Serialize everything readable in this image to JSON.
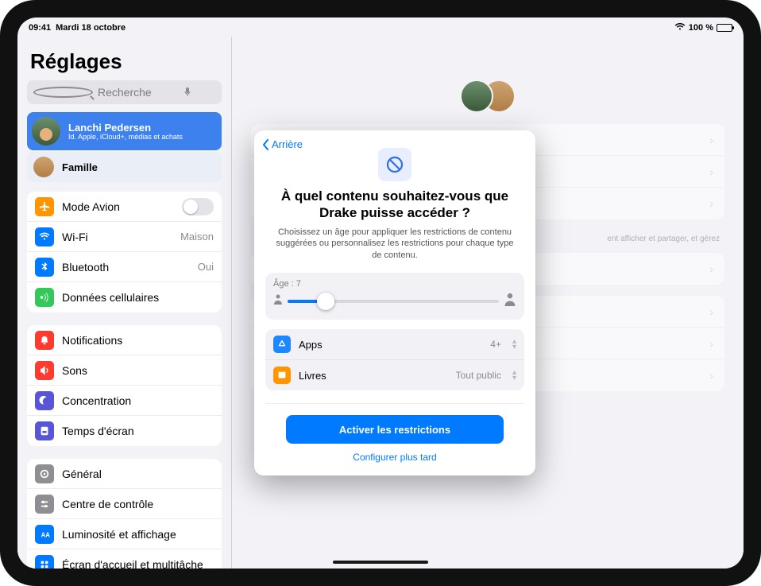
{
  "statusbar": {
    "time": "09:41",
    "date": "Mardi 18 octobre",
    "battery_text": "100 %"
  },
  "sidebar": {
    "title": "Réglages",
    "search_placeholder": "Recherche",
    "account": {
      "name": "Lanchi Pedersen",
      "sub": "Id. Apple, iCloud+, médias et achats"
    },
    "family_label": "Famille",
    "items": {
      "airplane": "Mode Avion",
      "wifi": "Wi-Fi",
      "wifi_value": "Maison",
      "bluetooth": "Bluetooth",
      "bluetooth_value": "Oui",
      "cellular": "Données cellulaires",
      "notifications": "Notifications",
      "sounds": "Sons",
      "focus": "Concentration",
      "screentime": "Temps d'écran",
      "general": "Général",
      "control_center": "Centre de contrôle",
      "display": "Luminosité et affichage",
      "home_screen": "Écran d'accueil et multitâche"
    }
  },
  "detail": {
    "note_fragment": "ent afficher et partager, et gérez"
  },
  "modal": {
    "back": "Arrière",
    "title": "À quel contenu souhaitez-vous que Drake puisse accéder ?",
    "subtitle": "Choisissez un âge pour appliquer les restrictions de contenu suggérées ou personnalisez les restrictions pour chaque type de contenu.",
    "age_label": "Âge : 7",
    "slider_percent": 18,
    "rows": [
      {
        "name": "Apps",
        "value": "4+",
        "icon_color": "#1e88ff",
        "glyph": "A"
      },
      {
        "name": "Livres",
        "value": "Tout public",
        "icon_color": "#ff9500",
        "glyph": "book"
      }
    ],
    "primary": "Activer les restrictions",
    "secondary": "Configurer plus tard"
  }
}
